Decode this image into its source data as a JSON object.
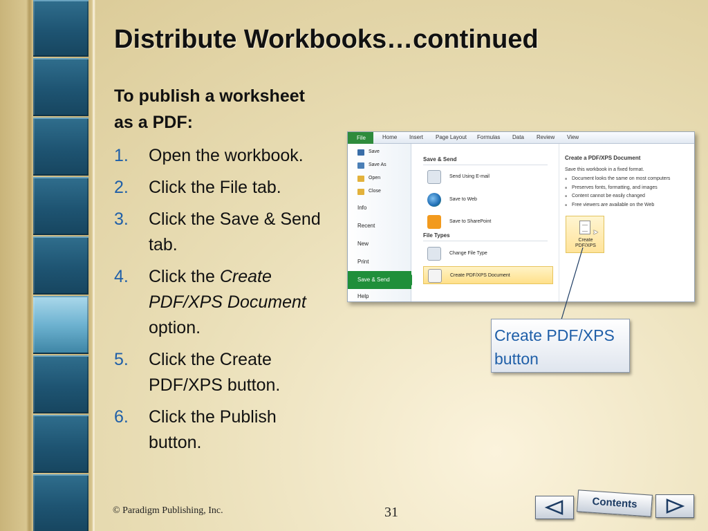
{
  "slide": {
    "title": "Distribute Workbooks…continued",
    "intro": "To publish a worksheet as a PDF:",
    "steps": [
      {
        "num": "1.",
        "text": "Open the workbook."
      },
      {
        "num": "2.",
        "text": "Click the File tab."
      },
      {
        "num": "3.",
        "text": "Click the Save & Send tab."
      },
      {
        "num": "4.",
        "pre": "Click the ",
        "italic": "Create PDF/XPS Document",
        "post": " option."
      },
      {
        "num": "5.",
        "text": "Click the Create PDF/XPS button."
      },
      {
        "num": "6.",
        "text": "Click the Publish button."
      }
    ],
    "callout": "Create PDF/XPS button",
    "copyright": "© Paradigm Publishing, Inc.",
    "page_number": "31",
    "contents_label": "Contents"
  },
  "excel": {
    "ribbon_tabs": [
      "File",
      "Home",
      "Insert",
      "Page Layout",
      "Formulas",
      "Data",
      "Review",
      "View"
    ],
    "backstage_items": [
      "Save",
      "Save As",
      "Open",
      "Close",
      "Info",
      "Recent",
      "New",
      "Print",
      "Save & Send",
      "Help"
    ],
    "save_send_header": "Save & Send",
    "save_send_options": [
      "Send Using E-mail",
      "Save to Web",
      "Save to SharePoint"
    ],
    "file_types_header": "File Types",
    "file_type_options": [
      "Change File Type",
      "Create PDF/XPS Document"
    ],
    "right_header": "Create a PDF/XPS Document",
    "right_desc": "Save this workbook in a fixed format.",
    "right_bullets": [
      "Document looks the same on most computers",
      "Preserves fonts, formatting, and images",
      "Content cannot be easily changed",
      "Free viewers are available on the Web"
    ],
    "create_button_line1": "Create",
    "create_button_line2": "PDF/XPS"
  },
  "colors": {
    "accent_blue": "#1f5fa8",
    "excel_green": "#1f8f3a"
  }
}
